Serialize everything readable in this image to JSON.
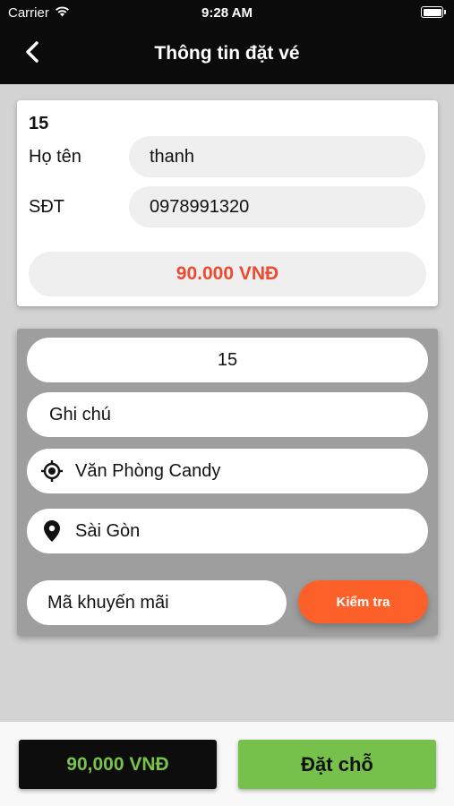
{
  "status_bar": {
    "carrier": "Carrier",
    "time": "9:28 AM",
    "battery_level": 1.0
  },
  "nav": {
    "title": "Thông tin đặt vé",
    "back_icon": "chevron-left-icon"
  },
  "passenger": {
    "seat_number": "15",
    "name_label": "Họ tên",
    "name_value": "thanh",
    "phone_label": "SĐT",
    "phone_value": "0978991320",
    "price": "90.000 VNĐ"
  },
  "booking": {
    "seat_field": "15",
    "note_placeholder": "Ghi chú",
    "pickup": {
      "icon": "gps-target-icon",
      "value": "Văn Phòng Candy"
    },
    "destination": {
      "icon": "map-pin-icon",
      "value": "Sài Gòn"
    },
    "promo_placeholder": "Mã khuyến mãi",
    "check_label": "Kiểm tra"
  },
  "footer": {
    "total": "90,000 VNĐ",
    "book_label": "Đặt chỗ"
  },
  "colors": {
    "header_bg": "#0b0b0b",
    "price_red": "#ec4a31",
    "accent_orange": "#fd6129",
    "accent_green": "#76c04c"
  }
}
